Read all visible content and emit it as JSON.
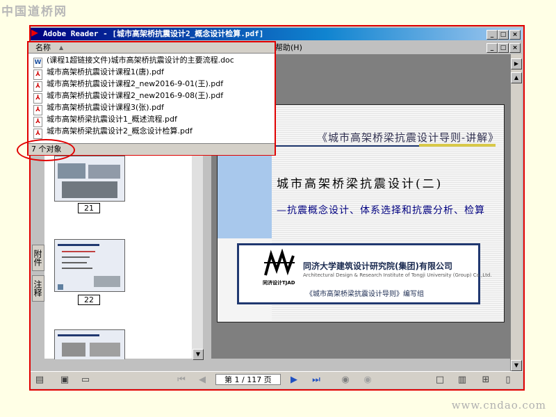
{
  "watermark_top": "中国道桥网",
  "watermark_bottom": "www.cndao.com",
  "window": {
    "title": "Adobe Reader - [城市高架桥抗震设计2_概念设计检算.pdf]",
    "menu_help": "帮助(H)",
    "minimize": "_",
    "maximize": "□",
    "close": "×"
  },
  "file_list": {
    "column_header": "名称",
    "items": [
      {
        "icon": "word-doc-icon",
        "name": "(课程1超链接文件)城市高架桥抗震设计的主要流程.doc"
      },
      {
        "icon": "pdf-file-icon",
        "name": "城市高架桥抗震设计课程1(唐).pdf"
      },
      {
        "icon": "pdf-file-icon",
        "name": "城市高架桥抗震设计课程2_new2016-9-01(王).pdf"
      },
      {
        "icon": "pdf-file-icon",
        "name": "城市高架桥抗震设计课程2_new2016-9-08(王).pdf"
      },
      {
        "icon": "pdf-file-icon",
        "name": "城市高架桥抗震设计课程3(张).pdf"
      },
      {
        "icon": "pdf-file-icon",
        "name": "城市高架桥梁抗震设计1_概述流程.pdf"
      },
      {
        "icon": "pdf-file-icon",
        "name": "城市高架桥梁抗震设计2_概念设计检算.pdf"
      }
    ],
    "status": "7 个对象"
  },
  "side_tabs": {
    "attachments": "附件",
    "comments": "注释"
  },
  "thumbnails": [
    {
      "page": "21"
    },
    {
      "page": "22"
    }
  ],
  "slide": {
    "guide_title": "《城市高架桥梁抗震设计导则-讲解》",
    "heading": "城市高架桥梁抗震设计(二)",
    "subheading": "—抗震概念设计、体系选择和抗震分析、检算",
    "org_name": "同济大学建筑设计研究院(集团)有限公司",
    "org_name_en": "Architectural Design & Research Institute of Tongji University (Group) Co.,Ltd.",
    "logo_caption": "同济设计TJAD",
    "compiler": "《城市高架桥梁抗震设计导则》编写组"
  },
  "toolbar": {
    "page_display": "第 1 / 117 页"
  },
  "colors": {
    "accent_red": "#e00000",
    "title_blue": "#000080",
    "slide_blue": "#a8c8ec"
  }
}
